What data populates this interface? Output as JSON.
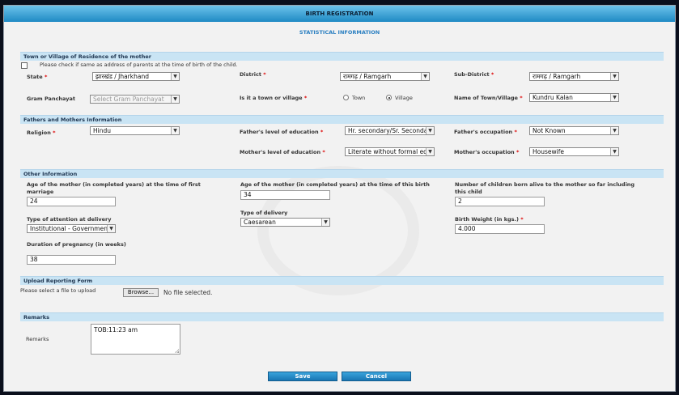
{
  "header": {
    "title": "BIRTH REGISTRATION",
    "subtitle": "STATISTICAL INFORMATION"
  },
  "residence": {
    "section_title": "Town or Village of Residence of the mother",
    "same_address_text": "Please check if same as address of parents at the time of birth of the child.",
    "state_label": "State",
    "state_value": "झारखंड / Jharkhand",
    "district_label": "District",
    "district_value": "रामगढ़ / Ramgarh",
    "subdistrict_label": "Sub-District",
    "subdistrict_value": "रामगढ़ / Ramgarh",
    "gram_label": "Gram Panchayat",
    "gram_value": "Select Gram Panchayat",
    "town_village_label": "Is it a town or village",
    "town_option": "Town",
    "village_option": "Village",
    "town_name_label": "Name of Town/Village",
    "town_name_value": "Kundru Kalan"
  },
  "parents": {
    "section_title": "Fathers and Mothers Information",
    "religion_label": "Religion",
    "religion_value": "Hindu",
    "father_edu_label": "Father's level of education",
    "father_edu_value": "Hr. secondary/Sr. Secondary",
    "father_occ_label": "Father's occupation",
    "father_occ_value": "Not Known",
    "mother_edu_label": "Mother's level of education",
    "mother_edu_value": "Literate without formal education",
    "mother_occ_label": "Mother's occupation",
    "mother_occ_value": "Housewife"
  },
  "other": {
    "section_title": "Other Information",
    "age_marriage_label": "Age of the mother (in completed years) at the time of first marriage",
    "age_marriage_value": "24",
    "age_birth_label": "Age of the mother (in completed years) at the time of this birth",
    "age_birth_value": "34",
    "children_label": "Number of children born alive to the mother so far including this child",
    "children_value": "2",
    "attention_label": "Type of attention at delivery",
    "attention_value": "Institutional - Government",
    "delivery_label": "Type of delivery",
    "delivery_value": "Caesarean",
    "weight_label": "Birth Weight (in kgs.)",
    "weight_value": "4.000",
    "duration_label": "Duration of pregnancy (in weeks)",
    "duration_value": "38"
  },
  "upload": {
    "section_title": "Upload Reporting Form",
    "prompt": "Please select a file to upload",
    "browse_label": "Browse...",
    "file_status": "No file selected."
  },
  "remarks": {
    "section_title": "Remarks",
    "label": "Remarks",
    "value": "TOB:11:23  am"
  },
  "actions": {
    "save_label": "Save",
    "cancel_label": "Cancel"
  },
  "colors": {
    "header_bar": "#1f8ac4",
    "section_bar": "#c9e4f4",
    "button": "#1976b3",
    "required": "#dd0000"
  }
}
